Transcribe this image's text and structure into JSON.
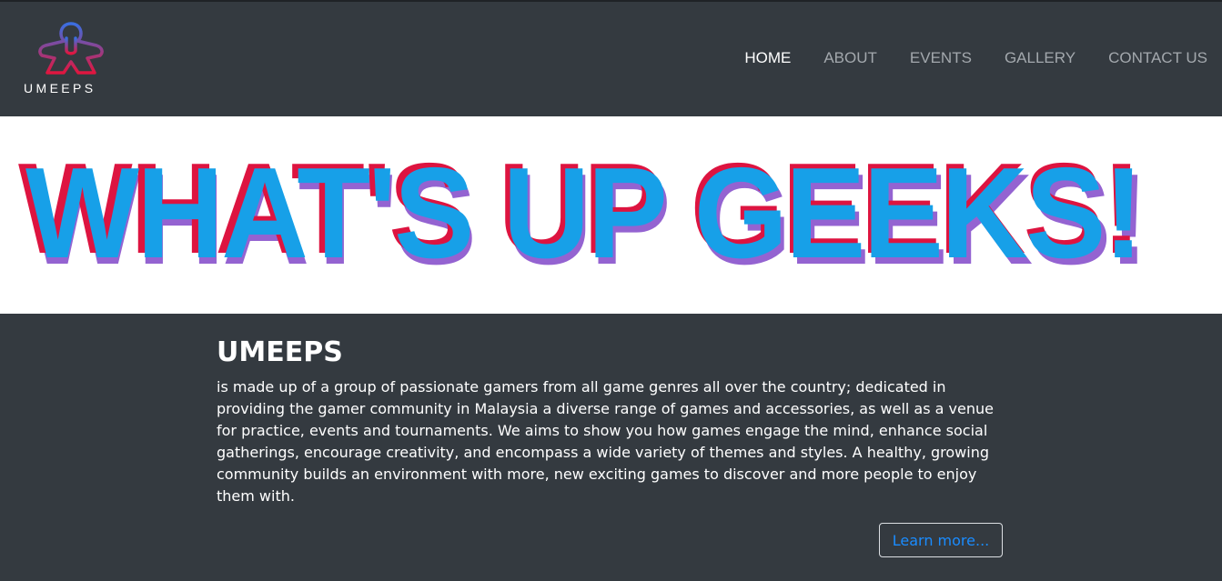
{
  "brand": {
    "name": "UMEEPS",
    "logo_icon": "meeple-icon",
    "colors": {
      "gradient_top": "#3b6ee0",
      "gradient_bottom": "#e0163f"
    }
  },
  "nav": {
    "items": [
      {
        "label": "HOME",
        "active": true
      },
      {
        "label": "ABOUT",
        "active": false
      },
      {
        "label": "EVENTS",
        "active": false
      },
      {
        "label": "GALLERY",
        "active": false
      },
      {
        "label": "CONTACT US",
        "active": false
      }
    ]
  },
  "hero": {
    "title": "WHAT'S UP GEEKS!",
    "colors": {
      "front": "#17a0e8",
      "back_red": "#dd1440",
      "back_purple": "#9463d1"
    }
  },
  "about": {
    "heading": "UMEEPS",
    "body": "is made up of a group of passionate gamers from all game genres all over the country; dedicated in providing the gamer community in Malaysia a diverse range of games and accessories, as well as a venue for practice, events and tournaments. We aims to show you how games engage the mind, enhance social gatherings, encourage creativity, and encompass a wide variety of themes and styles. A healthy, growing community builds an environment with more, new exciting games to discover and more people to enjoy them with.",
    "button_label": "Learn more..."
  },
  "theme": {
    "background": "#343a40",
    "nav_text": "#a3a8ad",
    "nav_active": "#ffffff",
    "link": "#1a8cff"
  }
}
